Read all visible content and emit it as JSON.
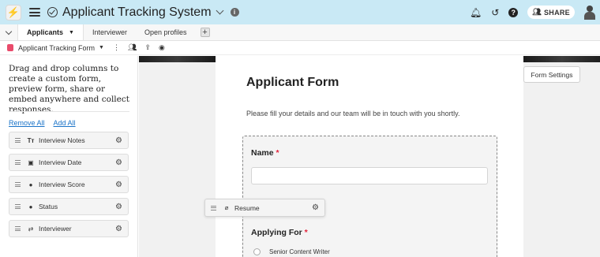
{
  "header": {
    "app_title": "Applicant Tracking System",
    "share_label": "SHARE",
    "icons": [
      "bolt-logo-icon",
      "hamburger-icon",
      "check-circle-icon",
      "chevron-down-icon",
      "info-icon",
      "bell-icon",
      "history-icon",
      "help-icon",
      "users-icon",
      "avatar"
    ]
  },
  "tabs": [
    {
      "label": "Applicants",
      "active": true
    },
    {
      "label": "Interviewer",
      "active": false
    },
    {
      "label": "Open profiles",
      "active": false
    }
  ],
  "viewbar": {
    "view_name": "Applicant Tracking Form",
    "form_badge_color": "#e94b6b"
  },
  "sidebar": {
    "description": "Drag and drop columns to create a custom form, preview form, share or embed anywhere and collect responses.",
    "remove_all": "Remove All",
    "add_all": "Add All",
    "fields": [
      {
        "label": "Interview Notes",
        "icon": "text-icon"
      },
      {
        "label": "Interview Date",
        "icon": "calendar-icon"
      },
      {
        "label": "Interview Score",
        "icon": "score-icon"
      },
      {
        "label": "Status",
        "icon": "status-icon"
      },
      {
        "label": "Interviewer",
        "icon": "link-icon"
      }
    ]
  },
  "form": {
    "title": "Applicant Form",
    "subtitle": "Please fill your details and our team will be in touch with you shortly.",
    "questions": [
      {
        "label": "Name",
        "required_mark": "*"
      },
      {
        "label": "Applying For",
        "required_mark": "*"
      }
    ],
    "options": [
      "Senior Content Writer"
    ],
    "settings_label": "Form Settings"
  },
  "dragging_field": {
    "label": "Resume",
    "icon": "attachment-icon"
  }
}
